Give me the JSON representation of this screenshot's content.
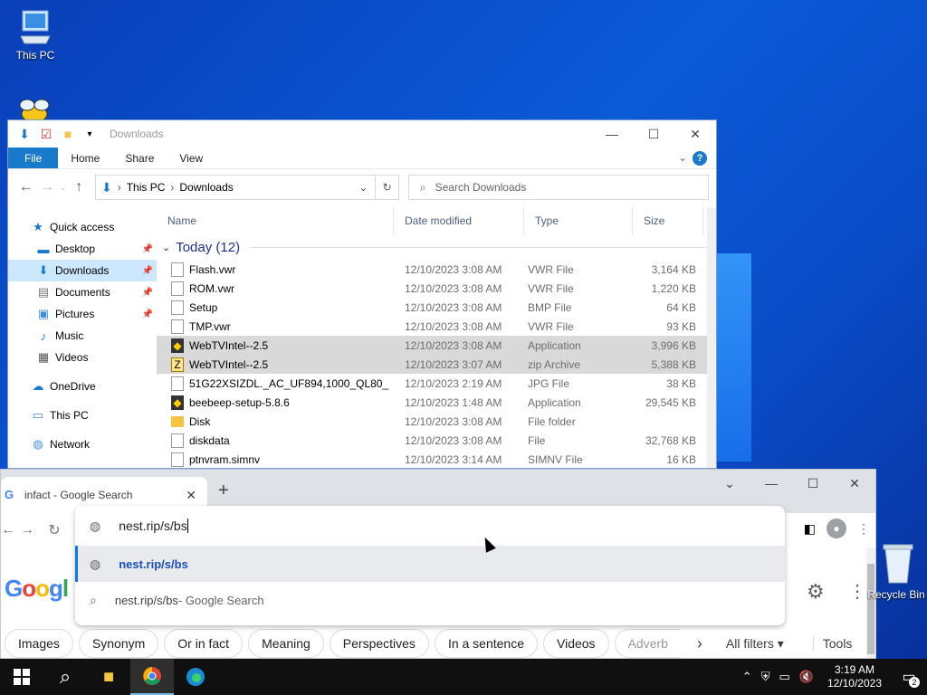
{
  "desktop": {
    "icons": [
      {
        "label": "This PC"
      },
      {
        "label": "Recycle Bin"
      }
    ]
  },
  "explorer": {
    "title": "Downloads",
    "ribbon_tabs": [
      "File",
      "Home",
      "Share",
      "View"
    ],
    "address": {
      "segments": [
        "This PC",
        "Downloads"
      ]
    },
    "search_placeholder": "Search Downloads",
    "nav": [
      {
        "label": "Quick access",
        "icon": "star-icon"
      },
      {
        "label": "Desktop",
        "icon": "desktop-icon",
        "pinned": true
      },
      {
        "label": "Downloads",
        "icon": "download-icon",
        "pinned": true,
        "selected": true
      },
      {
        "label": "Documents",
        "icon": "documents-icon",
        "pinned": true
      },
      {
        "label": "Pictures",
        "icon": "pictures-icon",
        "pinned": true
      },
      {
        "label": "Music",
        "icon": "music-icon"
      },
      {
        "label": "Videos",
        "icon": "videos-icon"
      },
      {
        "label": "OneDrive",
        "icon": "cloud-icon"
      },
      {
        "label": "This PC",
        "icon": "computer-icon"
      },
      {
        "label": "Network",
        "icon": "network-icon"
      }
    ],
    "columns": [
      "Name",
      "Date modified",
      "Type",
      "Size"
    ],
    "group": "Today (12)",
    "files": [
      {
        "name": "Flash.vwr",
        "date": "12/10/2023 3:08 AM",
        "type": "VWR File",
        "size": "3,164 KB",
        "icon": "doc"
      },
      {
        "name": "ROM.vwr",
        "date": "12/10/2023 3:08 AM",
        "type": "VWR File",
        "size": "1,220 KB",
        "icon": "doc"
      },
      {
        "name": "Setup",
        "date": "12/10/2023 3:08 AM",
        "type": "BMP File",
        "size": "64 KB",
        "icon": "doc"
      },
      {
        "name": "TMP.vwr",
        "date": "12/10/2023 3:08 AM",
        "type": "VWR File",
        "size": "93 KB",
        "icon": "doc"
      },
      {
        "name": "WebTVIntel--2.5",
        "date": "12/10/2023 3:08 AM",
        "type": "Application",
        "size": "3,996 KB",
        "icon": "app",
        "selected": true
      },
      {
        "name": "WebTVIntel--2.5",
        "date": "12/10/2023 3:07 AM",
        "type": "zip Archive",
        "size": "5,388 KB",
        "icon": "zip",
        "selected": true
      },
      {
        "name": "51G22XSIZDL._AC_UF894,1000_QL80_",
        "date": "12/10/2023 2:19 AM",
        "type": "JPG File",
        "size": "38 KB",
        "icon": "doc"
      },
      {
        "name": "beebeep-setup-5.8.6",
        "date": "12/10/2023 1:48 AM",
        "type": "Application",
        "size": "29,545 KB",
        "icon": "app"
      },
      {
        "name": "Disk",
        "date": "12/10/2023 3:08 AM",
        "type": "File folder",
        "size": "",
        "icon": "folder"
      },
      {
        "name": "diskdata",
        "date": "12/10/2023 3:08 AM",
        "type": "File",
        "size": "32,768 KB",
        "icon": "doc"
      },
      {
        "name": "ptnvram.simnv",
        "date": "12/10/2023 3:14 AM",
        "type": "SIMNV File",
        "size": "16 KB",
        "icon": "doc"
      }
    ]
  },
  "chrome": {
    "tab_title": "infact - Google Search",
    "omnibox_value": "nest.rip/s/bs",
    "suggestions": [
      {
        "url": "nest.rip/s/bs",
        "suffix": ""
      },
      {
        "url": "nest.rip/s/bs",
        "suffix": " - Google Search"
      }
    ],
    "logo": "Google",
    "chips": [
      "Images",
      "Synonym",
      "Or in fact",
      "Meaning",
      "Perspectives",
      "In a sentence",
      "Videos",
      "Adverb"
    ],
    "all_filters": "All filters ▾",
    "tools": "Tools"
  },
  "taskbar": {
    "time": "3:19 AM",
    "date": "12/10/2023",
    "notifications": "2"
  }
}
